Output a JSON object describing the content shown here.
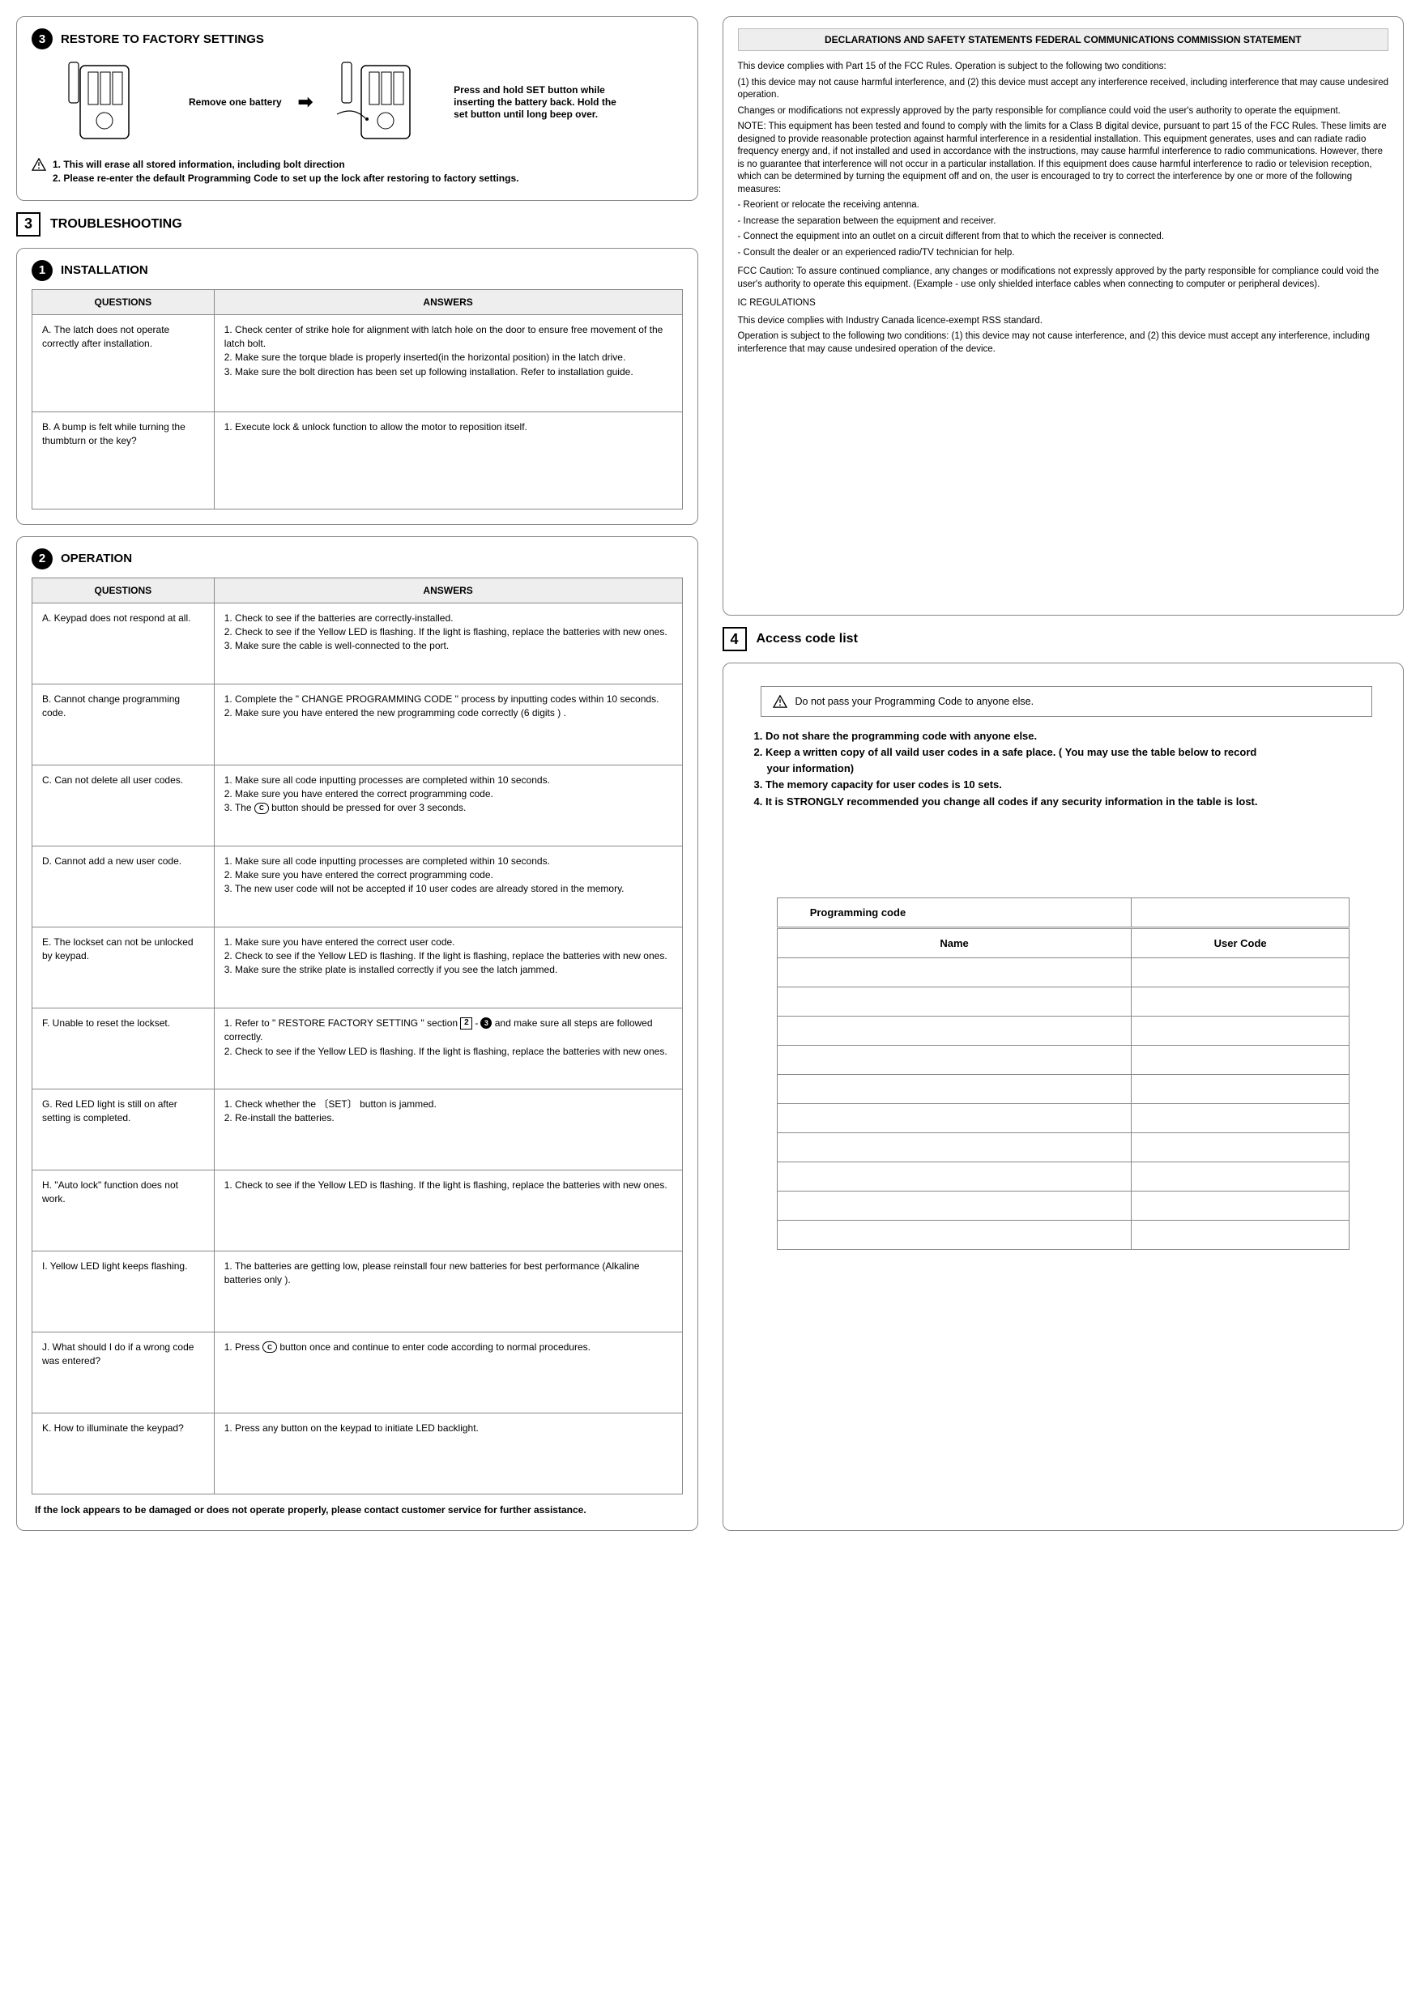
{
  "restore": {
    "num": "3",
    "title": "RESTORE TO FACTORY SETTINGS",
    "cap1": "Remove one battery",
    "cap2": "Press and hold SET button while inserting the battery back. Hold the set button until long beep over.",
    "warn": "1. This will erase all stored information, including bolt direction\n2. Please re-enter the default Programming Code to set up the lock after restoring to factory settings."
  },
  "trouble": {
    "num": "3",
    "title": "TROUBLESHOOTING",
    "install": {
      "num": "1",
      "title": "INSTALLATION",
      "h1": "QUESTIONS",
      "h2": "ANSWERS",
      "rows": [
        {
          "q": "A. The latch does not operate correctly after installation.",
          "a": "1. Check center of strike hole for alignment with latch hole on the door to ensure free movement of the latch bolt.\n2. Make sure the torque blade is properly inserted(in the horizontal position) in the latch drive.\n3. Make sure the bolt direction has been set up following installation. Refer to installation guide."
        },
        {
          "q": "B. A bump is felt while turning the thumbturn or the key?",
          "a": "1. Execute lock & unlock function to allow the motor to reposition itself."
        }
      ]
    },
    "operation": {
      "num": "2",
      "title": "OPERATION",
      "h1": "QUESTIONS",
      "h2": "ANSWERS",
      "rows": [
        {
          "q": "A. Keypad does not respond at all.",
          "a": "1. Check to see if the batteries are correctly-installed.\n2. Check to see if the Yellow LED is flashing. If the light is flashing, replace the batteries with new ones.\n3. Make sure the cable is well-connected to the port."
        },
        {
          "q": "B. Cannot change programming code.",
          "a": "1. Complete the \" CHANGE PROGRAMMING CODE \" process by inputting codes within 10 seconds.\n2. Make sure you have entered the new programming code correctly (6 digits ) ."
        },
        {
          "q": "C. Can not delete all user codes.",
          "a": "1. Make sure all code inputting processes are completed within 10 seconds.\n2. Make sure you have entered the correct programming code.\n3. The [C] button should be pressed for over 3 seconds."
        },
        {
          "q": "D. Cannot add a new user code.",
          "a": "1. Make sure all code inputting processes are completed within 10 seconds.\n2. Make sure you have entered the correct programming code.\n3. The new user code will not be accepted if 10 user codes are already stored in the memory."
        },
        {
          "q": "E. The lockset can not be unlocked by keypad.",
          "a": "1. Make sure you have entered the correct user code.\n2. Check to see if the Yellow LED is flashing. If the light is flashing, replace the batteries with new ones.\n3. Make sure the strike plate is installed correctly if you see the latch jammed."
        },
        {
          "q": "F. Unable to reset the lockset.",
          "a": "1. Refer to \" RESTORE FACTORY SETTING \"  section  [2]-[3]  and make sure all steps are   followed correctly.\n2. Check to see if the Yellow LED is flashing. If the light is flashing, replace the batteries with new ones."
        },
        {
          "q": "G. Red LED light is still on after setting is completed.",
          "a": "1. Check whether the 〔SET〕 button is jammed.\n2. Re-install the batteries."
        },
        {
          "q": "H. \"Auto lock\" function does not work.",
          "a": "1. Check to see if the Yellow LED is flashing. If the light is flashing, replace the batteries with new ones."
        },
        {
          "q": "I. Yellow LED light keeps flashing.",
          "a": "1. The batteries are getting low, please reinstall four new batteries for best performance (Alkaline batteries only )."
        },
        {
          "q": "J. What should I do if  a wrong code was entered?",
          "a": "1. Press [C] button once and continue to enter code according to normal procedures."
        },
        {
          "q": "K. How to illuminate the keypad?",
          "a": "1. Press any button on the keypad to initiate LED backlight."
        }
      ],
      "note": "If the lock appears to be damaged or does not operate properly, please contact customer service for further assistance."
    }
  },
  "decl": {
    "head": "DECLARATIONS AND SAFETY STATEMENTS FEDERAL COMMUNICATIONS COMMISSION STATEMENT",
    "p1": "This device complies with Part 15 of the FCC Rules. Operation is subject to the following two conditions:",
    "p2": "(1) this device may not cause harmful interference, and (2) this device must accept any interference received, including interference that may cause undesired operation.",
    "p3": "Changes or modifications not expressly approved by the party responsible for compliance could void the user's authority to operate the equipment.",
    "p4": "NOTE: This equipment has been tested and found to comply with the limits for a Class B digital device, pursuant to part 15 of the FCC Rules. These limits are designed to provide reasonable protection against harmful interference in a residential installation. This equipment generates, uses and can radiate radio frequency energy and, if not installed and used in accordance with the instructions, may cause harmful interference to radio communications. However, there is no guarantee that interference will not occur in a particular installation. If this equipment does cause harmful interference to radio or television reception, which can be determined by turning the equipment off and on, the user is encouraged to try to correct the interference by one or more of the following measures:",
    "b1": "- Reorient or relocate the receiving antenna.",
    "b2": "- Increase the separation between the equipment and receiver.",
    "b3": "- Connect the equipment into an outlet on a circuit different from that to which the receiver is connected.",
    "b4": "- Consult the dealer or an experienced radio/TV technician for help.",
    "p5": "FCC Caution: To assure continued compliance, any changes or modifications not expressly approved by the party responsible for compliance could void the user's authority to operate this equipment. (Example - use only shielded interface cables when connecting to computer or peripheral devices).",
    "ic": "IC REGULATIONS",
    "p6": "This device complies with Industry Canada licence-exempt RSS standard.",
    "p7": "Operation is subject to the following two conditions: (1) this device may not cause interference, and (2) this device must accept any interference, including interference that may cause undesired operation of the device."
  },
  "access": {
    "num": "4",
    "title": "Access code list",
    "warn": "Do not pass your Programming Code to anyone else.",
    "l1": "1. Do not share the programming code with anyone else.",
    "l2": "2. Keep a written copy of all vaild user codes in a safe place. ( You may use the table below  to record",
    "l2b": "your information)",
    "l3": "3. The memory capacity for user codes is 10 sets.",
    "l4": "4. It is STRONGLY recommended you change all codes if any security information in the table is lost.",
    "th1": "Programming code",
    "th2": "Name",
    "th3": "User Code",
    "rows": 10
  }
}
